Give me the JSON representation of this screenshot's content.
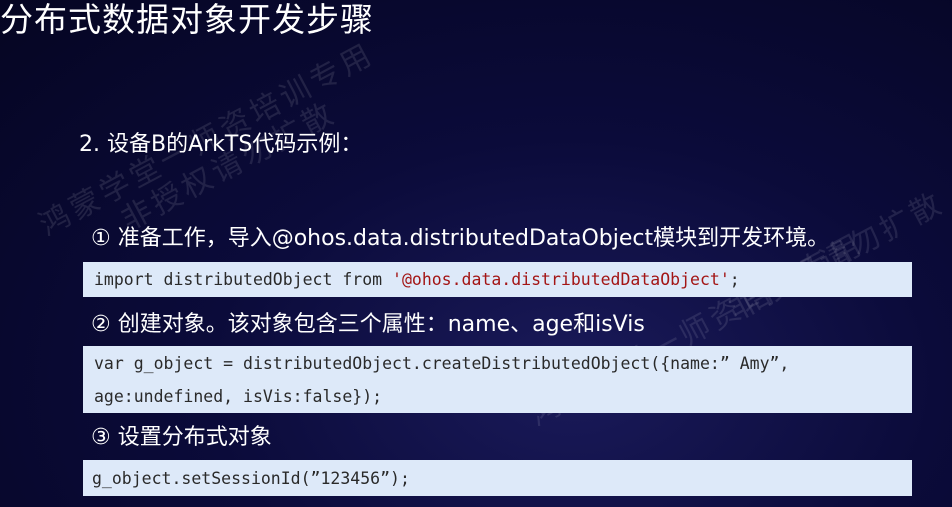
{
  "title": "分布式数据对象开发步骤",
  "subtitle": "2. 设备B的ArkTS代码示例：",
  "steps": [
    {
      "label": "① 准备工作，导入@ohos.data.distributedDataObject模块到开发环境。",
      "code_lines": [
        {
          "prefix": "import distributedObject from ",
          "string": "'@ohos.data.distributedDataObject'",
          "suffix": ";"
        }
      ]
    },
    {
      "label": "② 创建对象。该对象包含三个属性：name、age和isVis",
      "code_lines": [
        {
          "prefix": "var g_object = distributedObject.createDistributedObject({name:” Amy”,",
          "string": "",
          "suffix": ""
        },
        {
          "prefix": "age:undefined, isVis:false});",
          "string": "",
          "suffix": ""
        }
      ]
    },
    {
      "label": "③ 设置分布式对象",
      "code_lines": [
        {
          "prefix": "g_object.setSessionId(”123456”);",
          "string": "",
          "suffix": ""
        }
      ]
    }
  ],
  "watermarks": [
    "鸿蒙学堂一师资培训专用",
    "非授权请勿扩散",
    "鸿蒙学堂一师资培训专用",
    "非授权请勿扩散"
  ],
  "colors": {
    "background": "#0b0b3a",
    "code_background": "#dde9f9",
    "code_text": "#2a2a2a",
    "code_string": "#a31515",
    "text": "#ffffff"
  }
}
